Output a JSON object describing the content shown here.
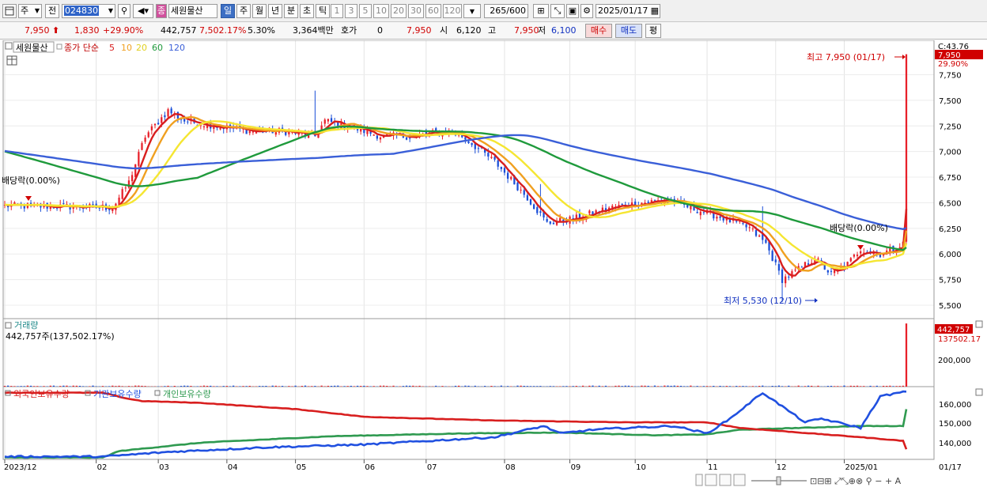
{
  "toolbar": {
    "period_select": "주",
    "prev_label": "전",
    "stock_code": "024830",
    "stock_name": "세원물산",
    "stock_tag": "종",
    "intervals": [
      "일",
      "주",
      "월",
      "년",
      "분",
      "초",
      "틱"
    ],
    "active_interval": "일",
    "minute_steps": [
      "1",
      "3",
      "5",
      "10",
      "20",
      "30",
      "60",
      "120"
    ],
    "count": "265",
    "count_max": "/600",
    "date": "2025/01/17"
  },
  "quote": {
    "price": "7,950",
    "change": "1,830",
    "change_pct": "+29.90%",
    "volume": "442,757",
    "volume_ratio": "7,502.17%",
    "turnover_pct": "5.30%",
    "amount": "3,364백만",
    "hoga_label": "호가",
    "hoga_value": "0",
    "ask": "7,950",
    "open_label": "시",
    "open": "6,120",
    "high_label": "고",
    "high": "7,950",
    "low_label": "저",
    "low": "6,100",
    "buy_label": "매수",
    "sell_label": "매도",
    "avg_label": "평"
  },
  "price_panel": {
    "stock_label": "세원물산",
    "ma_title": "종가 단순",
    "ma_periods": [
      "5",
      "10",
      "20",
      "60",
      "120"
    ],
    "last_price_box": "7,950",
    "c_label": "C:43.76",
    "pct_label": "29.90%",
    "high_marker": "최고 7,950 (01/17)",
    "low_marker": "최저 5,530 (12/10)",
    "dividend_left": "배당락(0.00%)",
    "dividend_right": "배당락(0.00%)"
  },
  "volume_panel": {
    "title": "거래량",
    "value_text": "442,757주(137,502.17%)",
    "last_box": "442,757",
    "ratio_label": "137502.17",
    "axis_tick": "200,000"
  },
  "holding_panel": {
    "legend": [
      "외국인보유수량",
      "기관보유수량",
      "개인보유수량"
    ],
    "axis_ticks": [
      "160,000",
      "150,000",
      "140,000"
    ]
  },
  "time_axis": {
    "labels": [
      "2023/12",
      "02",
      "03",
      "04",
      "05",
      "06",
      "07",
      "08",
      "09",
      "10",
      "11",
      "12",
      "2025/01",
      "01/17"
    ]
  },
  "colors": {
    "candle_up": "#e8202a",
    "candle_down": "#1a4ed8",
    "ma5": "#d81e1e",
    "ma10": "#f0a020",
    "ma20": "#f5e632",
    "ma60": "#1f9a3c",
    "ma120": "#3a5fd8",
    "foreign": "#d81e1e",
    "institution": "#2050e0",
    "individual": "#2f9a50"
  },
  "chart_data": {
    "type": "candlestick",
    "ylim": [
      5400,
      7950
    ],
    "y_ticks": [
      5500,
      5750,
      6000,
      6250,
      6500,
      6750,
      7000,
      7250,
      7500,
      7750
    ],
    "x_month_labels": [
      "2023/12",
      "02",
      "03",
      "04",
      "05",
      "06",
      "07",
      "08",
      "09",
      "10",
      "11",
      "12",
      "2025/01"
    ],
    "close_anchors": [
      [
        0,
        6470
      ],
      [
        25,
        6460
      ],
      [
        33,
        6450
      ],
      [
        38,
        6700
      ],
      [
        43,
        7150
      ],
      [
        50,
        7400
      ],
      [
        55,
        7300
      ],
      [
        65,
        7250
      ],
      [
        75,
        7200
      ],
      [
        85,
        7200
      ],
      [
        95,
        7150
      ],
      [
        98,
        7300
      ],
      [
        105,
        7250
      ],
      [
        115,
        7150
      ],
      [
        125,
        7150
      ],
      [
        135,
        7200
      ],
      [
        140,
        7150
      ],
      [
        150,
        6900
      ],
      [
        160,
        6550
      ],
      [
        166,
        6300
      ],
      [
        175,
        6350
      ],
      [
        185,
        6450
      ],
      [
        195,
        6500
      ],
      [
        203,
        6530
      ],
      [
        210,
        6450
      ],
      [
        220,
        6350
      ],
      [
        228,
        6250
      ],
      [
        233,
        6100
      ],
      [
        238,
        5750
      ],
      [
        243,
        5850
      ],
      [
        248,
        5960
      ],
      [
        253,
        5800
      ],
      [
        258,
        5900
      ],
      [
        262,
        6050
      ],
      [
        268,
        6000
      ],
      [
        272,
        6050
      ],
      [
        275,
        6100
      ],
      [
        276,
        7950
      ]
    ],
    "high": 7950,
    "high_date": "01/17",
    "low": 5530,
    "low_date": "12/10",
    "ma_periods": [
      5,
      10,
      20,
      60,
      120
    ],
    "volume_last": 442757,
    "volume_ticks": [
      200000
    ],
    "holding_ylim": [
      130000,
      168000
    ],
    "holding_ticks": [
      140000,
      150000,
      160000
    ],
    "foreign_anchors": [
      [
        0,
        166000
      ],
      [
        30,
        166000
      ],
      [
        37,
        163000
      ],
      [
        42,
        161500
      ],
      [
        60,
        160500
      ],
      [
        90,
        157000
      ],
      [
        110,
        153000
      ],
      [
        150,
        151000
      ],
      [
        190,
        150000
      ],
      [
        215,
        150000
      ],
      [
        225,
        147000
      ],
      [
        247,
        144000
      ],
      [
        262,
        142000
      ],
      [
        275,
        140000
      ],
      [
        277,
        131000
      ]
    ],
    "institution_anchors": [
      [
        0,
        131500
      ],
      [
        30,
        131500
      ],
      [
        50,
        134000
      ],
      [
        80,
        136500
      ],
      [
        110,
        138000
      ],
      [
        130,
        140000
      ],
      [
        150,
        142000
      ],
      [
        165,
        148000
      ],
      [
        170,
        144000
      ],
      [
        180,
        146000
      ],
      [
        190,
        147000
      ],
      [
        205,
        148000
      ],
      [
        215,
        144000
      ],
      [
        222,
        152000
      ],
      [
        232,
        166000
      ],
      [
        245,
        150000
      ],
      [
        250,
        152000
      ],
      [
        262,
        147000
      ],
      [
        268,
        164000
      ],
      [
        277,
        167000
      ]
    ],
    "individual_anchors": [
      [
        0,
        131000
      ],
      [
        30,
        131000
      ],
      [
        35,
        134500
      ],
      [
        60,
        139000
      ],
      [
        100,
        142500
      ],
      [
        140,
        144000
      ],
      [
        170,
        144500
      ],
      [
        200,
        143000
      ],
      [
        215,
        143500
      ],
      [
        225,
        146000
      ],
      [
        262,
        148000
      ],
      [
        275,
        148000
      ],
      [
        277,
        166500
      ]
    ]
  }
}
